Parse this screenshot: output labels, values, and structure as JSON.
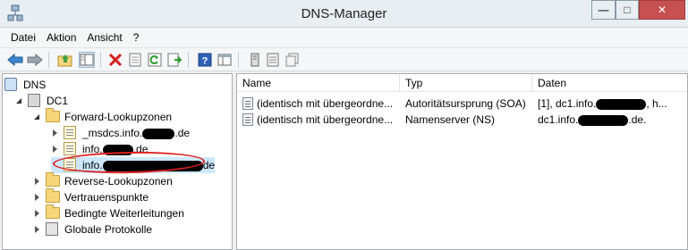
{
  "window": {
    "title": "DNS-Manager"
  },
  "menu": [
    "Datei",
    "Aktion",
    "Ansicht",
    "?"
  ],
  "toolbar": {
    "buttons": [
      "back-arrow-icon",
      "forward-arrow-icon",
      "up-folder-icon",
      "show-hide-tree-icon",
      "delete-icon",
      "properties-icon",
      "refresh-icon",
      "export-list-icon",
      "help-icon",
      "console-icon",
      "server-icon",
      "list-icon",
      "copy-icon"
    ]
  },
  "tree": {
    "root": "DNS",
    "server": "DC1",
    "forward_zones": "Forward-Lookupzonen",
    "zone1_prefix": "_msdcs.info.",
    "zone1_suffix": ".de",
    "zone2_prefix": "info.",
    "zone2_suffix": ".de",
    "zone3_prefix": "info.",
    "zone3_suffix": "de",
    "reverse_zones": "Reverse-Lookupzonen",
    "trust_points": "Vertrauenspunkte",
    "conditional_forwarders": "Bedingte Weiterleitungen",
    "global_logs": "Globale Protokolle"
  },
  "list": {
    "columns": [
      "Name",
      "Typ",
      "Daten"
    ],
    "rows": [
      {
        "name": "(identisch mit übergeordne...",
        "type": "Autoritätsursprung (SOA)",
        "data_prefix": "[1], dc1.info.",
        "data_suffix": ", h..."
      },
      {
        "name": "(identisch mit übergeordne...",
        "type": "Namenserver (NS)",
        "data_prefix": "dc1.info.",
        "data_suffix": ".de."
      }
    ]
  },
  "colors": {
    "annotation": "#e02020",
    "close_button": "#c75050",
    "folder": "#f5d67b"
  }
}
